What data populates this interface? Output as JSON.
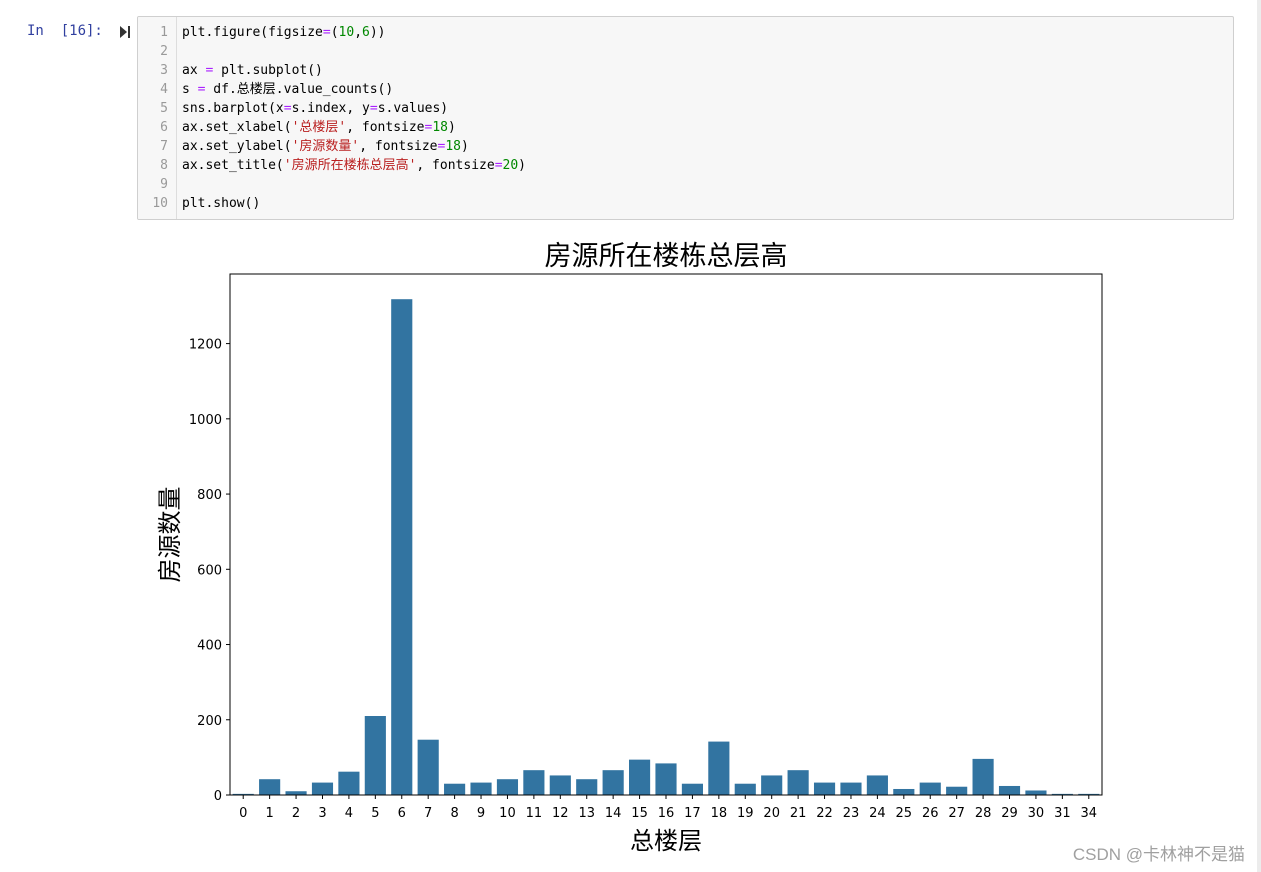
{
  "cell": {
    "prompt": "In  [16]:",
    "lines": [
      {
        "n": "1",
        "html": "plt.figure(figsize<span class=\"op\">=</span>(<span class=\"num\">10</span>,<span class=\"num\">6</span>))"
      },
      {
        "n": "2",
        "html": ""
      },
      {
        "n": "3",
        "html": "ax <span class=\"op\">=</span> plt.subplot()"
      },
      {
        "n": "4",
        "html": "s <span class=\"op\">=</span> df.总楼层.value_counts()"
      },
      {
        "n": "5",
        "html": "sns.barplot(x<span class=\"op\">=</span>s.index, y<span class=\"op\">=</span>s.values)"
      },
      {
        "n": "6",
        "html": "ax.set_xlabel(<span class=\"str\">'总楼层'</span>, fontsize<span class=\"op\">=</span><span class=\"num\">18</span>)"
      },
      {
        "n": "7",
        "html": "ax.set_ylabel(<span class=\"str\">'房源数量'</span>, fontsize<span class=\"op\">=</span><span class=\"num\">18</span>)"
      },
      {
        "n": "8",
        "html": "ax.set_title(<span class=\"str\">'房源所在楼栋总层高'</span>, fontsize<span class=\"op\">=</span><span class=\"num\">20</span>)"
      },
      {
        "n": "9",
        "html": ""
      },
      {
        "n": "10",
        "html": "plt.show()"
      }
    ]
  },
  "watermark": "CSDN @卡林神不是猫",
  "chart_data": {
    "type": "bar",
    "title": "房源所在楼栋总层高",
    "xlabel": "总楼层",
    "ylabel": "房源数量",
    "categories": [
      "0",
      "1",
      "2",
      "3",
      "4",
      "5",
      "6",
      "7",
      "8",
      "9",
      "10",
      "11",
      "12",
      "13",
      "14",
      "15",
      "16",
      "17",
      "18",
      "19",
      "20",
      "21",
      "22",
      "23",
      "24",
      "25",
      "26",
      "27",
      "28",
      "29",
      "30",
      "31",
      "34"
    ],
    "values": [
      3,
      42,
      10,
      33,
      62,
      210,
      1318,
      147,
      30,
      33,
      42,
      66,
      52,
      42,
      66,
      94,
      84,
      30,
      142,
      30,
      52,
      66,
      33,
      33,
      52,
      16,
      33,
      22,
      96,
      24,
      12,
      3,
      3
    ],
    "ylim": [
      0,
      1385
    ],
    "yticks": [
      0,
      200,
      400,
      600,
      800,
      1000,
      1200
    ],
    "bar_color": "#3274a1",
    "grid": false
  }
}
